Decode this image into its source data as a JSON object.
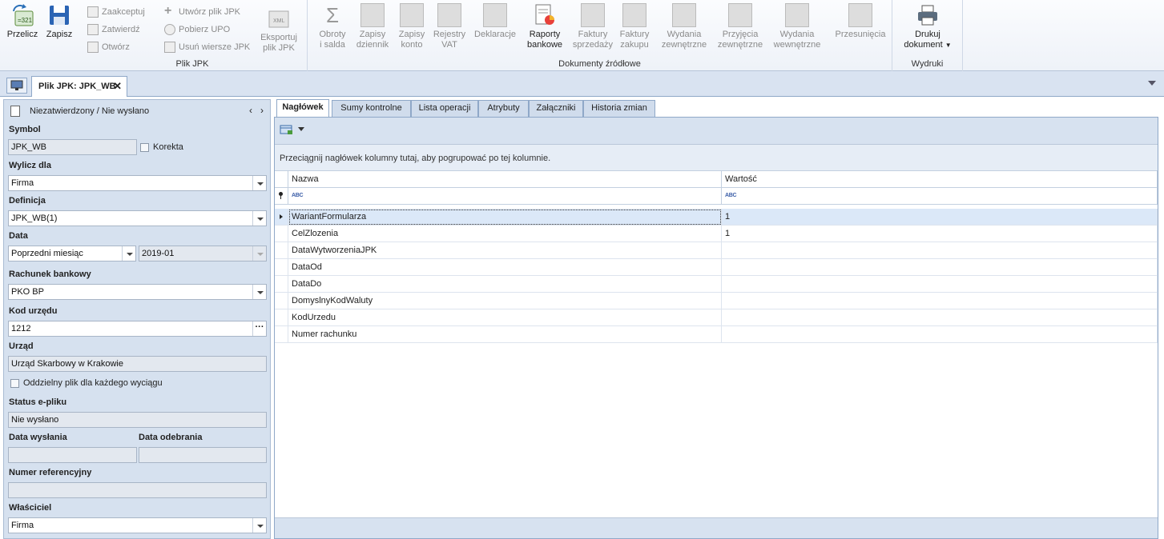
{
  "ribbon": {
    "przelicz": "Przelicz",
    "zapisz": "Zapisz",
    "plik_jpk_group": {
      "label": "Plik JPK",
      "zaakceptuj": "Zaakceptuj",
      "zatwierdz": "Zatwierdź",
      "otworz": "Otwórz",
      "utworz": "Utwórz plik JPK",
      "pobierz_upo": "Pobierz UPO",
      "usun_wiersze": "Usuń wiersze JPK",
      "eksportuj": [
        "Eksportuj",
        "plik JPK"
      ]
    },
    "dokumenty_group": {
      "label": "Dokumenty źródłowe",
      "buttons": [
        {
          "l1": "Obroty",
          "l2": "i salda"
        },
        {
          "l1": "Zapisy",
          "l2": "dziennik"
        },
        {
          "l1": "Zapisy",
          "l2": "konto"
        },
        {
          "l1": "Rejestry",
          "l2": "VAT"
        },
        {
          "l1": "Deklaracje",
          "l2": ""
        },
        {
          "l1": "Raporty",
          "l2": "bankowe"
        },
        {
          "l1": "Faktury",
          "l2": "sprzedaży"
        },
        {
          "l1": "Faktury",
          "l2": "zakupu"
        },
        {
          "l1": "Wydania",
          "l2": "zewnętrzne"
        },
        {
          "l1": "Przyjęcia",
          "l2": "zewnętrzne"
        },
        {
          "l1": "Wydania",
          "l2": "wewnętrzne"
        },
        {
          "l1": "Przesunięcia",
          "l2": ""
        }
      ]
    },
    "wydruki_group": {
      "label": "Wydruki",
      "drukuj_l1": "Drukuj",
      "drukuj_l2": "dokument"
    }
  },
  "tabstrip": {
    "doc_tab": "Plik JPK: JPK_WB"
  },
  "left": {
    "status_header": "Niezatwierdzony / Nie wysłano",
    "symbol_label": "Symbol",
    "symbol_value": "JPK_WB",
    "korekta_label": "Korekta",
    "wylicz_label": "Wylicz dla",
    "wylicz_value": "Firma",
    "definicja_label": "Definicja",
    "definicja_value": "JPK_WB(1)",
    "data_label": "Data",
    "data_mode": "Poprzedni miesiąc",
    "data_value": "2019-01",
    "rachunek_label": "Rachunek bankowy",
    "rachunek_value": "PKO BP",
    "kod_urzedu_label": "Kod urzędu",
    "kod_urzedu_value": "1212",
    "urzad_label": "Urząd",
    "urzad_value": "Urząd Skarbowy w Krakowie",
    "oddzielny_label": "Oddzielny plik dla każdego wyciągu",
    "status_label": "Status e-pliku",
    "status_value": "Nie wysłano",
    "data_wyslania_label": "Data wysłania",
    "data_odebrania_label": "Data odebrania",
    "numer_ref_label": "Numer referencyjny",
    "wlasciciel_label": "Właściciel",
    "wlasciciel_value": "Firma"
  },
  "right": {
    "tabs": [
      "Nagłówek",
      "Sumy kontrolne",
      "Lista operacji",
      "Atrybuty",
      "Załączniki",
      "Historia zmian"
    ],
    "group_hint": "Przeciągnij nagłówek kolumny tutaj, aby pogrupować po tej kolumnie.",
    "col_nazwa": "Nazwa",
    "col_wartosc": "Wartość",
    "filter_icon_text": "ABC",
    "rows": [
      {
        "nazwa": "WariantFormularza",
        "wartosc": "1"
      },
      {
        "nazwa": "CelZlozenia",
        "wartosc": "1"
      },
      {
        "nazwa": "DataWytworzeniaJPK",
        "wartosc": ""
      },
      {
        "nazwa": "DataOd",
        "wartosc": ""
      },
      {
        "nazwa": "DataDo",
        "wartosc": ""
      },
      {
        "nazwa": "DomyslnyKodWaluty",
        "wartosc": ""
      },
      {
        "nazwa": "KodUrzedu",
        "wartosc": ""
      },
      {
        "nazwa": "Numer rachunku",
        "wartosc": ""
      }
    ]
  }
}
